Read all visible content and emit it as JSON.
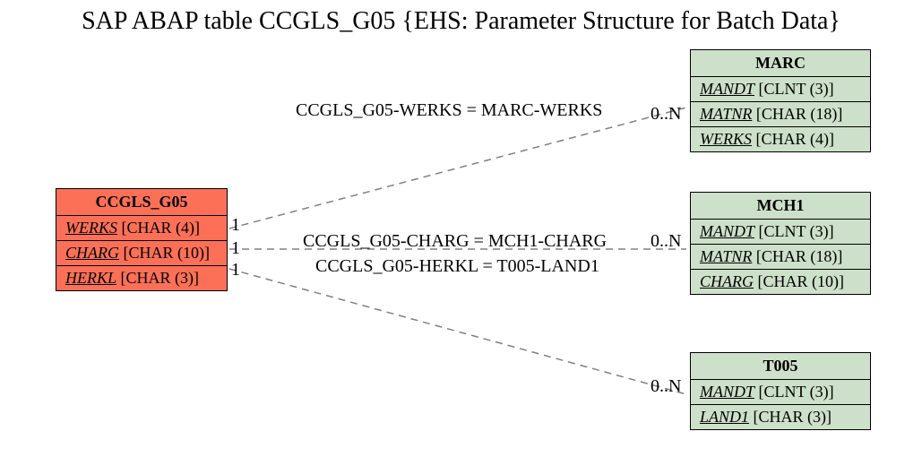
{
  "title": "SAP ABAP table CCGLS_G05 {EHS: Parameter Structure for Batch Data}",
  "main_entity": {
    "name": "CCGLS_G05",
    "fields": [
      {
        "name": "WERKS",
        "type": "[CHAR (4)]"
      },
      {
        "name": "CHARG",
        "type": "[CHAR (10)]"
      },
      {
        "name": "HERKL",
        "type": "[CHAR (3)]"
      }
    ]
  },
  "related_entities": [
    {
      "name": "MARC",
      "fields": [
        {
          "name": "MANDT",
          "type": "[CLNT (3)]"
        },
        {
          "name": "MATNR",
          "type": "[CHAR (18)]"
        },
        {
          "name": "WERKS",
          "type": "[CHAR (4)]"
        }
      ]
    },
    {
      "name": "MCH1",
      "fields": [
        {
          "name": "MANDT",
          "type": "[CLNT (3)]"
        },
        {
          "name": "MATNR",
          "type": "[CHAR (18)]"
        },
        {
          "name": "CHARG",
          "type": "[CHAR (10)]"
        }
      ]
    },
    {
      "name": "T005",
      "fields": [
        {
          "name": "MANDT",
          "type": "[CLNT (3)]"
        },
        {
          "name": "LAND1",
          "type": "[CHAR (3)]"
        }
      ]
    }
  ],
  "relations": [
    {
      "label": "CCGLS_G05-WERKS = MARC-WERKS",
      "src_card": "1",
      "dst_card": "0..N"
    },
    {
      "label": "CCGLS_G05-CHARG = MCH1-CHARG",
      "src_card": "1",
      "dst_card": "0..N"
    },
    {
      "label": "CCGLS_G05-HERKL = T005-LAND1",
      "src_card": "1",
      "dst_card": "0..N"
    }
  ]
}
